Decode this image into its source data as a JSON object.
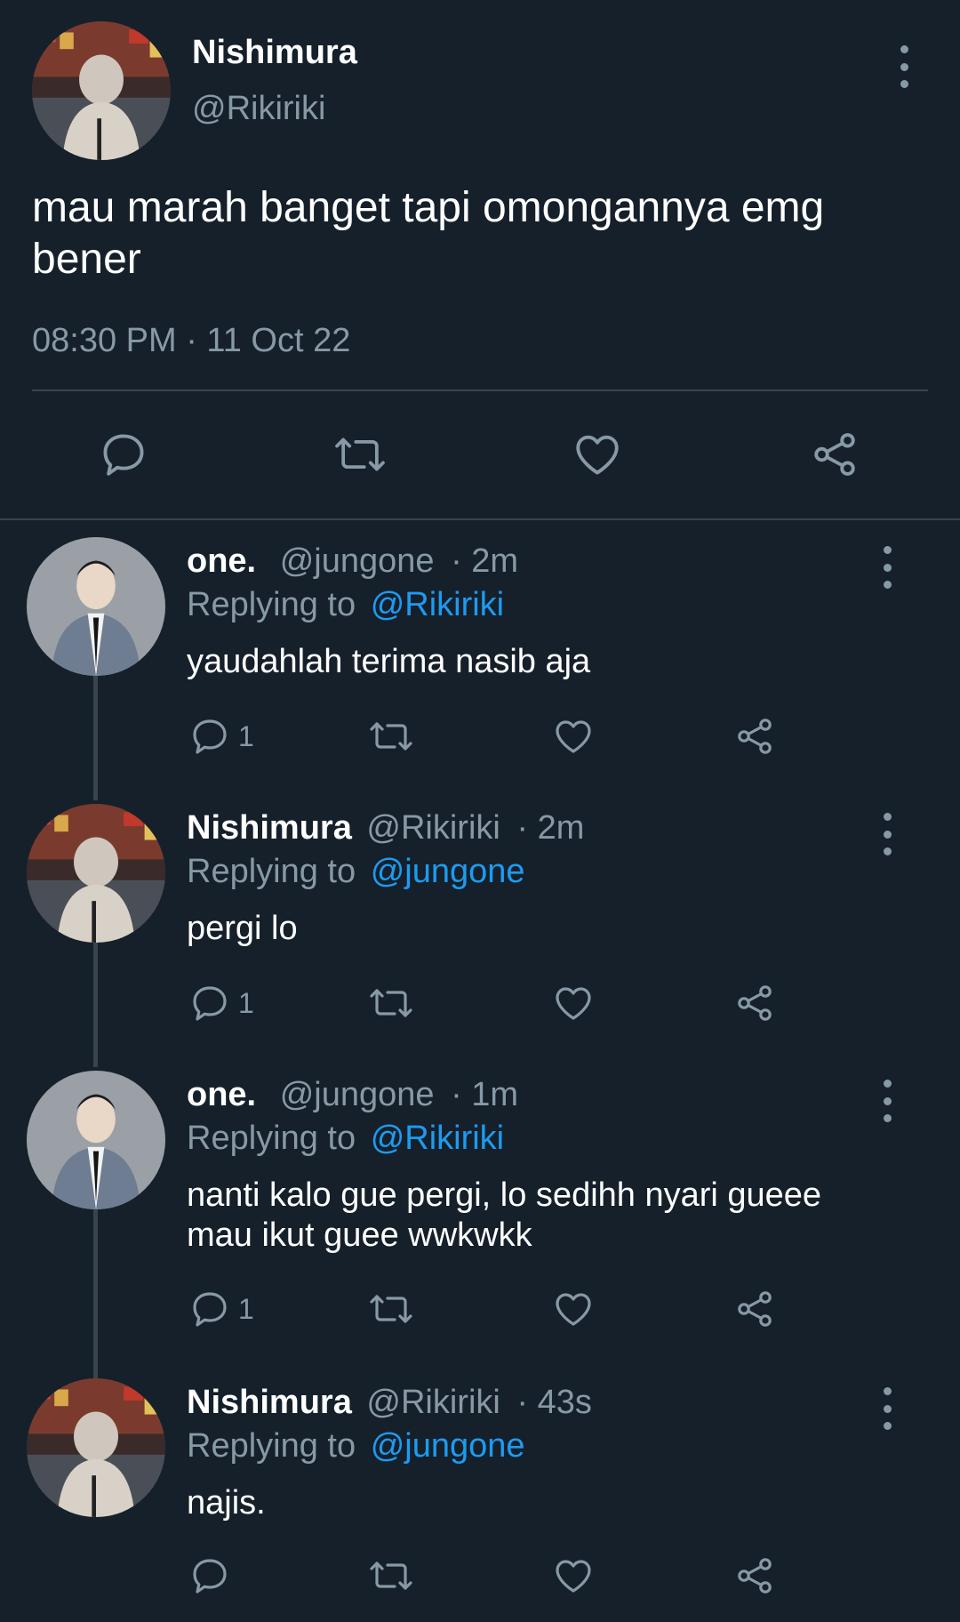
{
  "main_tweet": {
    "display_name": "Nishimura",
    "handle": "@Rikiriki",
    "text": "mau marah banget tapi omongannya emg bener",
    "timestamp": "08:30 PM · 11 Oct 22",
    "actions": [
      "reply-icon",
      "retweet-icon",
      "like-icon",
      "share-icon"
    ]
  },
  "replies": [
    {
      "display_name": "one.",
      "handle": "@jungone",
      "time": "· 2m",
      "replying_label": "Replying to",
      "replying_to": "@Rikiriki",
      "text": "yaudahlah terima nasib aja",
      "reply_count": "1"
    },
    {
      "display_name": "Nishimura",
      "handle": "@Rikiriki",
      "time": "· 2m",
      "replying_label": "Replying to",
      "replying_to": "@jungone",
      "text": "pergi lo",
      "reply_count": "1"
    },
    {
      "display_name": "one.",
      "handle": "@jungone",
      "time": "· 1m",
      "replying_label": "Replying to",
      "replying_to": "@Rikiriki",
      "text": "nanti kalo gue pergi, lo sedihh nyari gueee mau ikut guee wwkwkk",
      "reply_count": "1"
    },
    {
      "display_name": "Nishimura",
      "handle": "@Rikiriki",
      "time": "· 43s",
      "replying_label": "Replying to",
      "replying_to": "@jungone",
      "text": "najis.",
      "reply_count": ""
    }
  ],
  "colors": {
    "background": "#15202b",
    "muted": "#8899a6",
    "link": "#1d9bf0",
    "divider": "#38444d"
  }
}
